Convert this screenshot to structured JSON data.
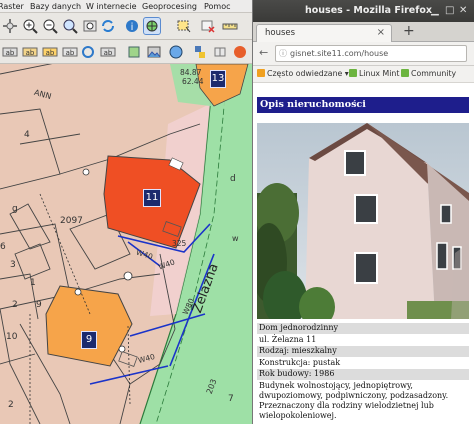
{
  "qgis": {
    "menu": [
      {
        "label": "Raster"
      },
      {
        "label": "Bazy danych"
      },
      {
        "label": "W internecie"
      },
      {
        "label": "Geoprocesing"
      },
      {
        "label": "Pomoc"
      }
    ],
    "map": {
      "parcels": [
        {
          "label": "13",
          "color": "#f6a44a"
        },
        {
          "label": "11",
          "color": "#ef4f24"
        },
        {
          "label": "9",
          "color": "#f6a44a"
        }
      ],
      "texts": {
        "ann": "ANN",
        "n2097": "2097",
        "n1": "1",
        "n2": "2",
        "n3": "3",
        "n4": "4",
        "n6": "6",
        "n9": "9",
        "n10": "10",
        "g": "g",
        "w": "w",
        "d": "d",
        "elev1": "84.87",
        "elev2": "62.44",
        "elev325": "325",
        "w40": "W40",
        "w40b": "W40",
        "w40c": "W40",
        "w80": "W80",
        "street": "Żelazna",
        "n203": "203",
        "n7": "7",
        "n2b": "2"
      },
      "colors": {
        "background": "#e9c8b6",
        "street": "#9ee0a6",
        "line_blue": "#1a33c9"
      }
    },
    "tool_icons": [
      "open-icon",
      "save-icon",
      "pan-icon",
      "zoom-in-icon",
      "zoom-out-icon",
      "zoom-full-icon",
      "zoom-layer-icon",
      "refresh-icon",
      "identify-icon",
      "select-icon",
      "deselect-icon",
      "measure-icon"
    ]
  },
  "firefox": {
    "window_title": "houses - Mozilla Firefox",
    "tab_label": "houses",
    "tab_close": "×",
    "new_tab": "+",
    "url": "gisnet.site11.com/house",
    "nav_back": "←",
    "bookmarks": [
      {
        "label": "Często odwiedzane",
        "icon": "star-icon"
      },
      {
        "label": "Linux Mint",
        "icon": "mint-icon"
      },
      {
        "label": "Community",
        "icon": "community-icon"
      }
    ],
    "page": {
      "heading": "Opis nieruchomości",
      "rows": [
        {
          "text": "Dom jednorodzinny"
        },
        {
          "text": "ul. Żelazna 11"
        },
        {
          "text": "Rodzaj: mieszkalny"
        },
        {
          "text": "Konstrukcja: pustak"
        },
        {
          "text": "Rok budowy: 1986"
        },
        {
          "text": "Budynek wolnostojący, jednopiętrowy, dwupoziomowy, podpiwniczony, podzasadzony. Przeznaczony dla rodziny wielodzietnej lub wielopokoleniowej."
        }
      ]
    }
  }
}
